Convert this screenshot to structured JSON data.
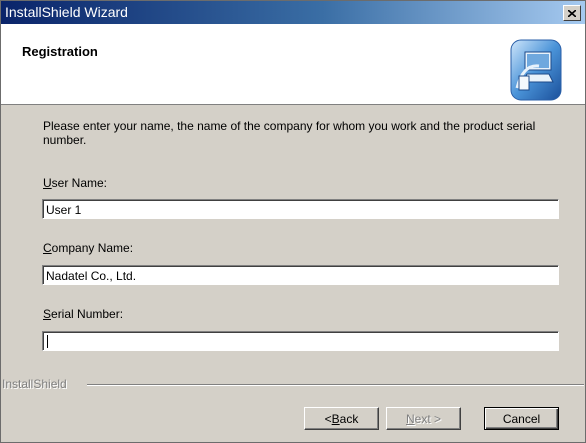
{
  "window": {
    "title": "InstallShield Wizard"
  },
  "header": {
    "title": "Registration",
    "icon": "computer-install-icon"
  },
  "intro": "Please enter your name, the name of the company for whom you work and the product serial number.",
  "fields": {
    "user_name": {
      "label_mnemonic": "U",
      "label_rest": "ser Name:",
      "value": "User 1"
    },
    "company_name": {
      "label_mnemonic": "C",
      "label_rest": "ompany Name:",
      "value": "Nadatel Co., Ltd."
    },
    "serial_number": {
      "label_mnemonic": "S",
      "label_rest": "erial Number:",
      "value": ""
    }
  },
  "brand": "InstallShield",
  "buttons": {
    "back": {
      "prefix": "< ",
      "mnemonic": "B",
      "rest": "ack"
    },
    "next": {
      "mnemonic": "N",
      "rest": "ext >"
    },
    "cancel": "Cancel"
  }
}
